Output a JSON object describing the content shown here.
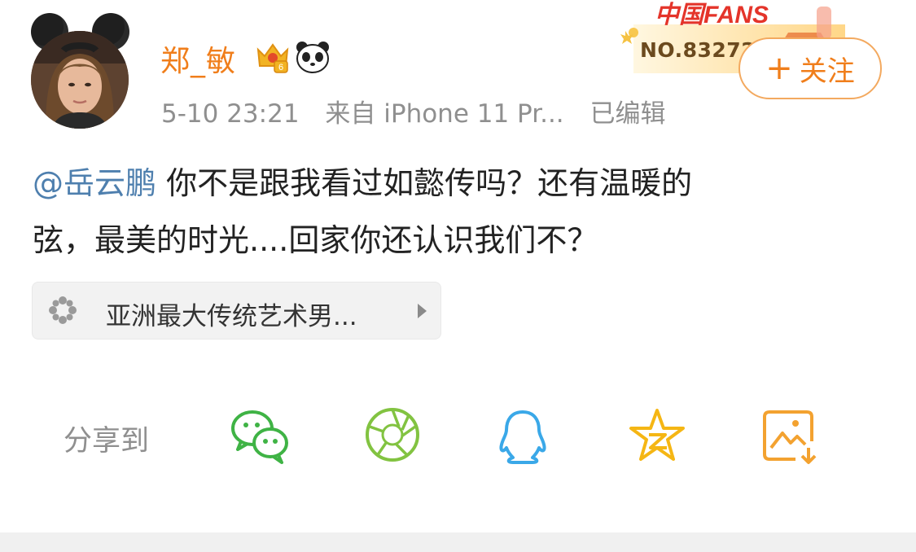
{
  "post": {
    "username": "郑_敏",
    "timestamp": "5-10 23:21",
    "source": "来自 iPhone 11 Pr...",
    "edited_label": "已编辑",
    "mention": "@岳云鹏",
    "body_line1": " 你不是跟我看过如懿传吗？还有温暖的",
    "body_line2": "弦，最美的时光....回家你还认识我们不？"
  },
  "badges": {
    "fans_title": "中国FANS",
    "fans_number": "NO.832727",
    "vip_level": "6"
  },
  "follow_button": {
    "plus": "+",
    "label": "关注"
  },
  "topic": {
    "text": "亚洲最大传统艺术男..."
  },
  "share": {
    "label": "分享到",
    "targets": [
      "wechat-icon",
      "moments-icon",
      "qq-icon",
      "qzone-icon",
      "save-image-icon"
    ]
  },
  "colors": {
    "username": "#f07e1b",
    "mention": "#4e7fae",
    "wechat": "#3fb345",
    "moments": "#82c341",
    "qq": "#3aa8e8",
    "qzone": "#f5b614",
    "save": "#f3a230"
  }
}
